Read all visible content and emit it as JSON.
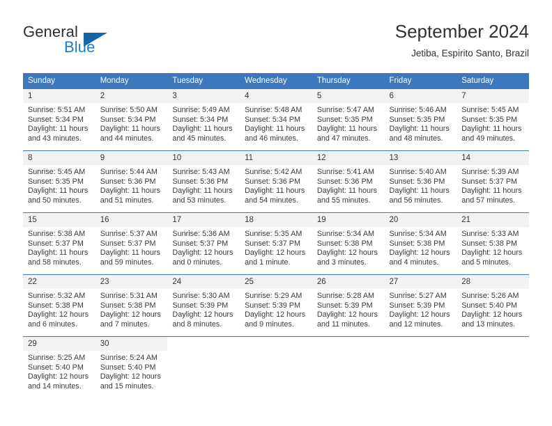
{
  "brand": {
    "name_part1": "General",
    "name_part2": "Blue",
    "accent_color": "#1c7bc4",
    "triangle_color": "#1565a8"
  },
  "header": {
    "title": "September 2024",
    "location": "Jetiba, Espirito Santo, Brazil"
  },
  "theme": {
    "header_blue": "#3b78be",
    "daynum_band": "#f2f2f2",
    "text": "#3a3a3a"
  },
  "weekday_headers": [
    "Sunday",
    "Monday",
    "Tuesday",
    "Wednesday",
    "Thursday",
    "Friday",
    "Saturday"
  ],
  "weeks": [
    [
      {
        "day": "1",
        "sunrise": "Sunrise: 5:51 AM",
        "sunset": "Sunset: 5:34 PM",
        "daylight1": "Daylight: 11 hours",
        "daylight2": "and 43 minutes."
      },
      {
        "day": "2",
        "sunrise": "Sunrise: 5:50 AM",
        "sunset": "Sunset: 5:34 PM",
        "daylight1": "Daylight: 11 hours",
        "daylight2": "and 44 minutes."
      },
      {
        "day": "3",
        "sunrise": "Sunrise: 5:49 AM",
        "sunset": "Sunset: 5:34 PM",
        "daylight1": "Daylight: 11 hours",
        "daylight2": "and 45 minutes."
      },
      {
        "day": "4",
        "sunrise": "Sunrise: 5:48 AM",
        "sunset": "Sunset: 5:34 PM",
        "daylight1": "Daylight: 11 hours",
        "daylight2": "and 46 minutes."
      },
      {
        "day": "5",
        "sunrise": "Sunrise: 5:47 AM",
        "sunset": "Sunset: 5:35 PM",
        "daylight1": "Daylight: 11 hours",
        "daylight2": "and 47 minutes."
      },
      {
        "day": "6",
        "sunrise": "Sunrise: 5:46 AM",
        "sunset": "Sunset: 5:35 PM",
        "daylight1": "Daylight: 11 hours",
        "daylight2": "and 48 minutes."
      },
      {
        "day": "7",
        "sunrise": "Sunrise: 5:45 AM",
        "sunset": "Sunset: 5:35 PM",
        "daylight1": "Daylight: 11 hours",
        "daylight2": "and 49 minutes."
      }
    ],
    [
      {
        "day": "8",
        "sunrise": "Sunrise: 5:45 AM",
        "sunset": "Sunset: 5:35 PM",
        "daylight1": "Daylight: 11 hours",
        "daylight2": "and 50 minutes."
      },
      {
        "day": "9",
        "sunrise": "Sunrise: 5:44 AM",
        "sunset": "Sunset: 5:36 PM",
        "daylight1": "Daylight: 11 hours",
        "daylight2": "and 51 minutes."
      },
      {
        "day": "10",
        "sunrise": "Sunrise: 5:43 AM",
        "sunset": "Sunset: 5:36 PM",
        "daylight1": "Daylight: 11 hours",
        "daylight2": "and 53 minutes."
      },
      {
        "day": "11",
        "sunrise": "Sunrise: 5:42 AM",
        "sunset": "Sunset: 5:36 PM",
        "daylight1": "Daylight: 11 hours",
        "daylight2": "and 54 minutes."
      },
      {
        "day": "12",
        "sunrise": "Sunrise: 5:41 AM",
        "sunset": "Sunset: 5:36 PM",
        "daylight1": "Daylight: 11 hours",
        "daylight2": "and 55 minutes."
      },
      {
        "day": "13",
        "sunrise": "Sunrise: 5:40 AM",
        "sunset": "Sunset: 5:36 PM",
        "daylight1": "Daylight: 11 hours",
        "daylight2": "and 56 minutes."
      },
      {
        "day": "14",
        "sunrise": "Sunrise: 5:39 AM",
        "sunset": "Sunset: 5:37 PM",
        "daylight1": "Daylight: 11 hours",
        "daylight2": "and 57 minutes."
      }
    ],
    [
      {
        "day": "15",
        "sunrise": "Sunrise: 5:38 AM",
        "sunset": "Sunset: 5:37 PM",
        "daylight1": "Daylight: 11 hours",
        "daylight2": "and 58 minutes."
      },
      {
        "day": "16",
        "sunrise": "Sunrise: 5:37 AM",
        "sunset": "Sunset: 5:37 PM",
        "daylight1": "Daylight: 11 hours",
        "daylight2": "and 59 minutes."
      },
      {
        "day": "17",
        "sunrise": "Sunrise: 5:36 AM",
        "sunset": "Sunset: 5:37 PM",
        "daylight1": "Daylight: 12 hours",
        "daylight2": "and 0 minutes."
      },
      {
        "day": "18",
        "sunrise": "Sunrise: 5:35 AM",
        "sunset": "Sunset: 5:37 PM",
        "daylight1": "Daylight: 12 hours",
        "daylight2": "and 1 minute."
      },
      {
        "day": "19",
        "sunrise": "Sunrise: 5:34 AM",
        "sunset": "Sunset: 5:38 PM",
        "daylight1": "Daylight: 12 hours",
        "daylight2": "and 3 minutes."
      },
      {
        "day": "20",
        "sunrise": "Sunrise: 5:34 AM",
        "sunset": "Sunset: 5:38 PM",
        "daylight1": "Daylight: 12 hours",
        "daylight2": "and 4 minutes."
      },
      {
        "day": "21",
        "sunrise": "Sunrise: 5:33 AM",
        "sunset": "Sunset: 5:38 PM",
        "daylight1": "Daylight: 12 hours",
        "daylight2": "and 5 minutes."
      }
    ],
    [
      {
        "day": "22",
        "sunrise": "Sunrise: 5:32 AM",
        "sunset": "Sunset: 5:38 PM",
        "daylight1": "Daylight: 12 hours",
        "daylight2": "and 6 minutes."
      },
      {
        "day": "23",
        "sunrise": "Sunrise: 5:31 AM",
        "sunset": "Sunset: 5:38 PM",
        "daylight1": "Daylight: 12 hours",
        "daylight2": "and 7 minutes."
      },
      {
        "day": "24",
        "sunrise": "Sunrise: 5:30 AM",
        "sunset": "Sunset: 5:39 PM",
        "daylight1": "Daylight: 12 hours",
        "daylight2": "and 8 minutes."
      },
      {
        "day": "25",
        "sunrise": "Sunrise: 5:29 AM",
        "sunset": "Sunset: 5:39 PM",
        "daylight1": "Daylight: 12 hours",
        "daylight2": "and 9 minutes."
      },
      {
        "day": "26",
        "sunrise": "Sunrise: 5:28 AM",
        "sunset": "Sunset: 5:39 PM",
        "daylight1": "Daylight: 12 hours",
        "daylight2": "and 11 minutes."
      },
      {
        "day": "27",
        "sunrise": "Sunrise: 5:27 AM",
        "sunset": "Sunset: 5:39 PM",
        "daylight1": "Daylight: 12 hours",
        "daylight2": "and 12 minutes."
      },
      {
        "day": "28",
        "sunrise": "Sunrise: 5:26 AM",
        "sunset": "Sunset: 5:40 PM",
        "daylight1": "Daylight: 12 hours",
        "daylight2": "and 13 minutes."
      }
    ],
    [
      {
        "day": "29",
        "sunrise": "Sunrise: 5:25 AM",
        "sunset": "Sunset: 5:40 PM",
        "daylight1": "Daylight: 12 hours",
        "daylight2": "and 14 minutes."
      },
      {
        "day": "30",
        "sunrise": "Sunrise: 5:24 AM",
        "sunset": "Sunset: 5:40 PM",
        "daylight1": "Daylight: 12 hours",
        "daylight2": "and 15 minutes."
      },
      {
        "day": "",
        "sunrise": "",
        "sunset": "",
        "daylight1": "",
        "daylight2": ""
      },
      {
        "day": "",
        "sunrise": "",
        "sunset": "",
        "daylight1": "",
        "daylight2": ""
      },
      {
        "day": "",
        "sunrise": "",
        "sunset": "",
        "daylight1": "",
        "daylight2": ""
      },
      {
        "day": "",
        "sunrise": "",
        "sunset": "",
        "daylight1": "",
        "daylight2": ""
      },
      {
        "day": "",
        "sunrise": "",
        "sunset": "",
        "daylight1": "",
        "daylight2": ""
      }
    ]
  ]
}
